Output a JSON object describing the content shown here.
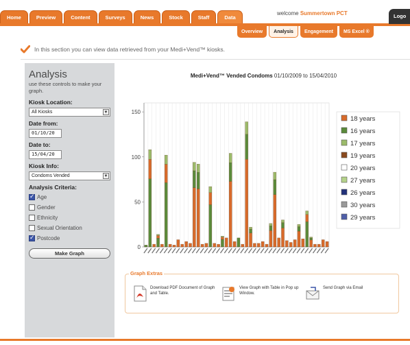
{
  "nav": {
    "main_tabs": [
      "Home",
      "Preview",
      "Content",
      "Surveys",
      "News",
      "Stock",
      "Staff",
      "Data"
    ],
    "active_main": "Data",
    "welcome_prefix": "welcome",
    "welcome_org": "Summertown PCT",
    "logout_label": "Logo",
    "sub_tabs": [
      "Overview",
      "Analysis",
      "Engagement",
      "MS Excel ®"
    ],
    "active_sub": "Analysis",
    "accent_color": "#e8792b"
  },
  "info": {
    "text": "In this section you can view data retrieved from your Medi+Vend™ kiosks.",
    "icon": "check-icon"
  },
  "panel": {
    "title": "Analysis",
    "description": "use these controls to make your graph.",
    "kiosk_label": "Kiosk Location:",
    "kiosk_value": "All Kiosks",
    "date_from_label": "Date from:",
    "date_from_value": "01/10/20",
    "date_to_label": "Date to:",
    "date_to_value": "15/04/20",
    "kiosk_info_label": "Kiosk Info:",
    "kiosk_info_value": "Condoms Vended",
    "criteria_label": "Analysis Criteria:",
    "criteria": [
      {
        "label": "Age",
        "checked": true
      },
      {
        "label": "Gender",
        "checked": false
      },
      {
        "label": "Ethnicity",
        "checked": false
      },
      {
        "label": "Sexual Orientation",
        "checked": false
      },
      {
        "label": "Postcode",
        "checked": true
      }
    ],
    "make_graph_label": "Make Graph"
  },
  "chart_data": {
    "type": "bar",
    "stacked": true,
    "title_bold": "Medi+Vend™ Vended Condoms",
    "title_range": "01/10/2009 to 15/04/2010",
    "ylim": [
      0,
      160
    ],
    "yticks": [
      0,
      50,
      100,
      150
    ],
    "grid": true,
    "legend_position": "right",
    "series": [
      {
        "name": "18 years",
        "color": "#d86a2a"
      },
      {
        "name": "16 years",
        "color": "#5a8a3a"
      },
      {
        "name": "17 years",
        "color": "#9bbb6a"
      },
      {
        "name": "19 years",
        "color": "#8a4a1e"
      },
      {
        "name": "20 years",
        "color": "#ffffff"
      },
      {
        "name": "27 years",
        "color": "#b4d28a"
      },
      {
        "name": "26 years",
        "color": "#23327a"
      },
      {
        "name": "30 years",
        "color": "#9a9a9a"
      },
      {
        "name": "29 years",
        "color": "#4f5fa8"
      }
    ],
    "bars": [
      {
        "total": 2,
        "main": 1
      },
      {
        "total": 108,
        "main": 1
      },
      {
        "total": 3,
        "main": 0
      },
      {
        "total": 14,
        "main": 1
      },
      {
        "total": 3,
        "main": 0
      },
      {
        "total": 102,
        "main": 1
      },
      {
        "total": 3,
        "main": 0
      },
      {
        "total": 2,
        "main": 0
      },
      {
        "total": 8,
        "main": 0
      },
      {
        "total": 3,
        "main": 0
      },
      {
        "total": 6,
        "main": 0
      },
      {
        "total": 4,
        "main": 0
      },
      {
        "total": 94,
        "main": 0
      },
      {
        "total": 92,
        "main": 0
      },
      {
        "total": 3,
        "main": 0
      },
      {
        "total": 4,
        "main": 0
      },
      {
        "total": 67,
        "main": 1
      },
      {
        "total": 4,
        "main": 0
      },
      {
        "total": 3,
        "main": 0
      },
      {
        "total": 12,
        "main": 1
      },
      {
        "total": 10,
        "main": 0
      },
      {
        "total": 104,
        "main": 0
      },
      {
        "total": 6,
        "main": 0
      },
      {
        "total": 10,
        "main": 1
      },
      {
        "total": 3,
        "main": 0
      },
      {
        "total": 139,
        "main": 0
      },
      {
        "total": 22,
        "main": 0
      },
      {
        "total": 4,
        "main": 0
      },
      {
        "total": 4,
        "main": 0
      },
      {
        "total": 6,
        "main": 0
      },
      {
        "total": 3,
        "main": 0
      },
      {
        "total": 26,
        "main": 0
      },
      {
        "total": 83,
        "main": 0
      },
      {
        "total": 10,
        "main": 0
      },
      {
        "total": 30,
        "main": 0
      },
      {
        "total": 7,
        "main": 0
      },
      {
        "total": 5,
        "main": 0
      },
      {
        "total": 8,
        "main": 0
      },
      {
        "total": 25,
        "main": 0
      },
      {
        "total": 9,
        "main": 0
      },
      {
        "total": 40,
        "main": 1
      },
      {
        "total": 11,
        "main": 0
      },
      {
        "total": 3,
        "main": 0
      },
      {
        "total": 3,
        "main": 0
      },
      {
        "total": 8,
        "main": 0
      },
      {
        "total": 6,
        "main": 0
      }
    ]
  },
  "extras": {
    "title": "Graph Extras",
    "items": [
      {
        "text": "Download PDF Document of Graph and Table.",
        "icon": "pdf-icon"
      },
      {
        "text": "View Graph with Table in Pop up Window.",
        "icon": "popup-window-icon"
      },
      {
        "text": "Send Graph via Email",
        "icon": "email-icon"
      }
    ]
  }
}
